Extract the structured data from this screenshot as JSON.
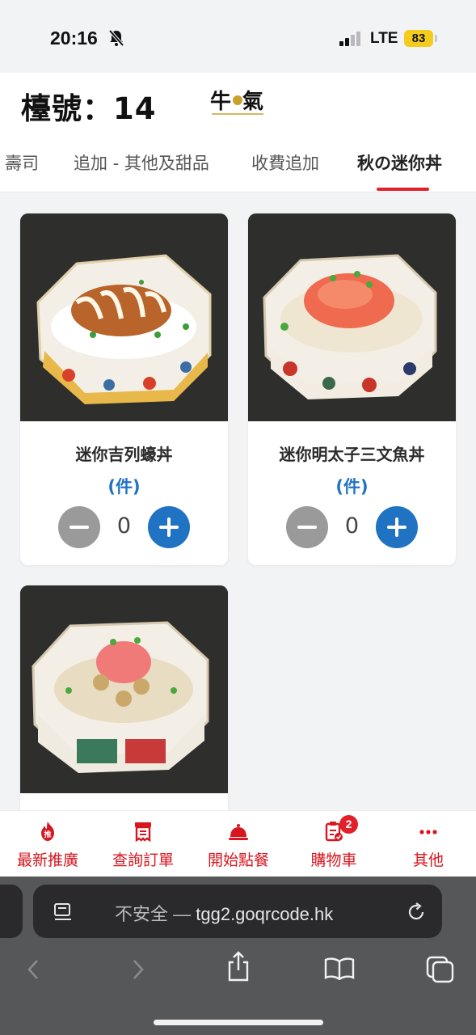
{
  "status_bar": {
    "time": "20:16",
    "network": "LTE",
    "battery": "83"
  },
  "header": {
    "table_label": "檯號：14",
    "logo_text": "牛氣"
  },
  "tabs": [
    {
      "label": "壽司"
    },
    {
      "label": "追加 - 其他及甜品"
    },
    {
      "label": "收費追加"
    },
    {
      "label": "秋の迷你丼",
      "active": true
    }
  ],
  "products": [
    {
      "name": "迷你吉列蠔丼",
      "unit": "(件)",
      "qty": "0"
    },
    {
      "name": "迷你明太子三文魚丼",
      "unit": "(件)",
      "qty": "0"
    },
    {
      "name": "",
      "unit": "",
      "qty": ""
    }
  ],
  "bottom_nav": [
    {
      "label": "最新推廣",
      "icon": "flame-promo-icon"
    },
    {
      "label": "查詢訂單",
      "icon": "receipt-icon"
    },
    {
      "label": "開始點餐",
      "icon": "cloche-icon"
    },
    {
      "label": "購物車",
      "icon": "cart-clipboard-icon",
      "badge": "2"
    },
    {
      "label": "其他",
      "icon": "more-dots-icon"
    }
  ],
  "browser": {
    "insecure_label": "不安全 —",
    "url": "tgg2.goqrcode.hk"
  },
  "colors": {
    "accent_red": "#e0202a",
    "brand_blue": "#1f73c2",
    "minus_gray": "#9a9a9a"
  }
}
